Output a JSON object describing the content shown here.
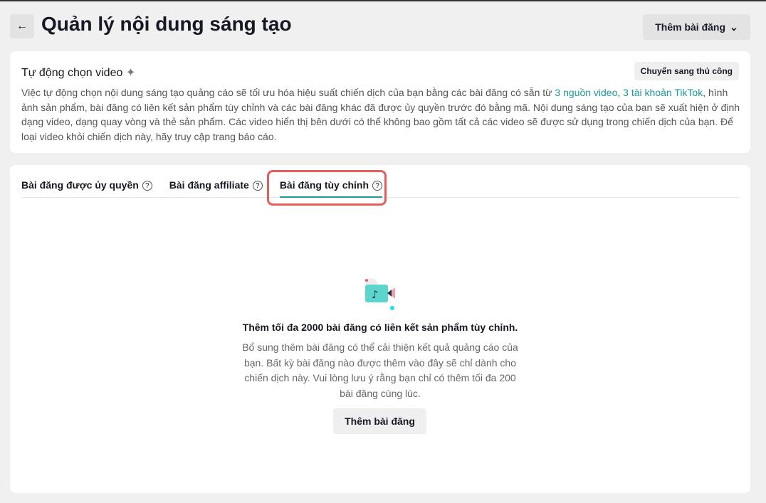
{
  "header": {
    "title": "Quản lý nội dung sáng tạo",
    "add_post": "Thêm bài đăng"
  },
  "auto": {
    "title": "Tự động chọn video",
    "switch_manual": "Chuyển sang thủ công",
    "desc_before": "Việc tự động chọn nội dung sáng tạo quảng cáo sẽ tối ưu hóa hiệu suất chiến dịch của bạn bằng các bài đăng có sẵn từ ",
    "link1": "3 nguồn video",
    "sep": ", ",
    "link2": "3 tài khoản TikTok",
    "desc_after": ", hình ảnh sản phẩm, bài đăng có liên kết sản phẩm tùy chỉnh và các bài đăng khác đã được ủy quyền trước đó bằng mã. Nội dung sáng tạo của bạn sẽ xuất hiện ở định dạng video, dạng quay vòng và thẻ sản phẩm. Các video hiển thị bên dưới có thể không bao gồm tất cả các video sẽ được sử dụng trong chiến dịch của bạn. Để loại video khỏi chiến dịch này, hãy truy cập trang báo cáo."
  },
  "tabs": [
    {
      "label": "Bài đăng được ủy quyền"
    },
    {
      "label": "Bài đăng affiliate"
    },
    {
      "label": "Bài đăng tùy chỉnh"
    }
  ],
  "empty": {
    "title": "Thêm tối đa 2000 bài đăng có liên kết sản phẩm tùy chỉnh.",
    "desc": "Bổ sung thêm bài đăng có thể cải thiện kết quả quảng cáo của bạn. Bất kỳ bài đăng nào được thêm vào đây sẽ chỉ dành cho chiến dịch này. Vui lòng lưu ý rằng bạn chỉ có thêm tối đa 200 bài đăng cùng lúc.",
    "button": "Thêm bài đăng"
  }
}
